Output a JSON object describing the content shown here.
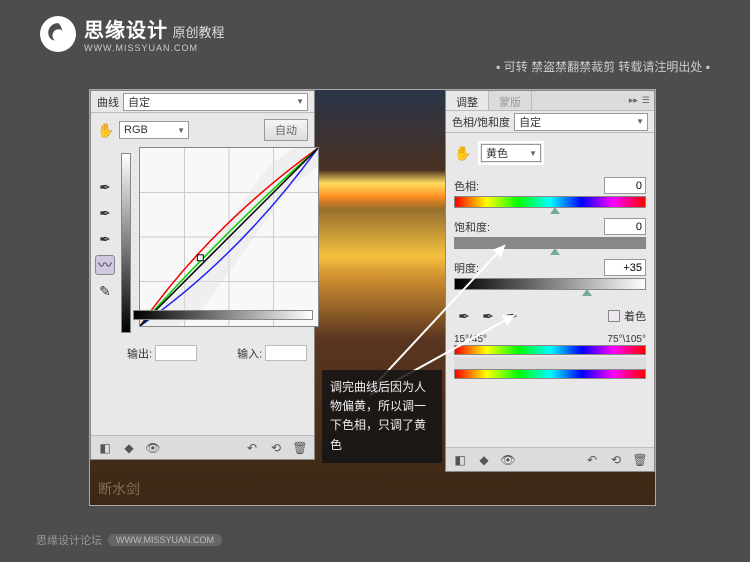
{
  "branding": {
    "title": "思缘设计",
    "subtitle": "原创教程",
    "url": "WWW.MISSYUAN.COM"
  },
  "topNotice": "▪ 可转  禁盗禁翻禁裁剪   转载请注明出处 ▪",
  "curvesPanel": {
    "title": "曲线",
    "preset": "自定",
    "channel": "RGB",
    "autoBtn": "自动",
    "outputLabel": "输出:",
    "inputLabel": "输入:"
  },
  "huePanel": {
    "tabs": {
      "adjust": "调整",
      "mask": "蒙版"
    },
    "title": "色相/饱和度",
    "preset": "自定",
    "colorRange": "黄色",
    "hue": {
      "label": "色相:",
      "value": "0"
    },
    "saturation": {
      "label": "饱和度:",
      "value": "0"
    },
    "lightness": {
      "label": "明度:",
      "value": "+35"
    },
    "colorize": "着色",
    "rangeLeft": "15°/45°",
    "rangeRight": "75°\\105°"
  },
  "tooltip": "调完曲线后因为人物偏黄，所以调一下色相，只调了黄色",
  "watermark": "断水剑",
  "footer": {
    "label": "思缘设计论坛",
    "url": "WWW.MISSYUAN.COM"
  }
}
